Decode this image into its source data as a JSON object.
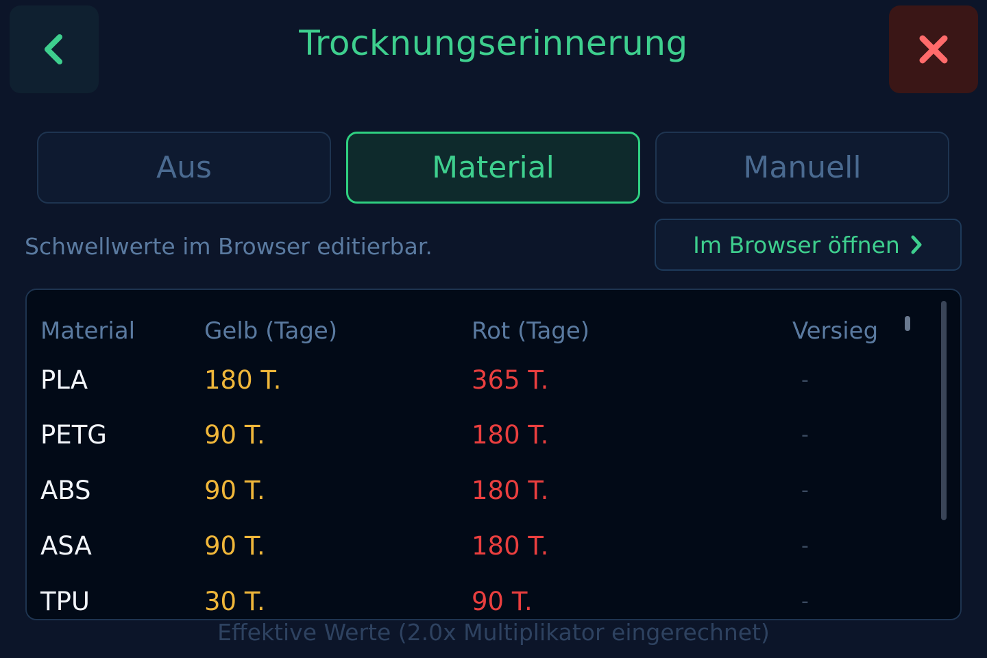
{
  "header": {
    "title": "Trocknungserinnerung",
    "back_icon": "chevron-left-icon",
    "close_icon": "close-icon"
  },
  "tabs": [
    {
      "label": "Aus",
      "active": false
    },
    {
      "label": "Material",
      "active": true
    },
    {
      "label": "Manuell",
      "active": false
    }
  ],
  "hint": "Schwellwerte im Browser editierbar.",
  "open_browser": {
    "label": "Im Browser öffnen",
    "icon": "chevron-right-icon"
  },
  "table": {
    "headers": {
      "material": "Material",
      "yellow": "Gelb (Tage)",
      "red": "Rot (Tage)",
      "sealed": "Versieg"
    },
    "rows": [
      {
        "material": "PLA",
        "yellow": "180 T.",
        "red": "365 T.",
        "sealed": "-"
      },
      {
        "material": "PETG",
        "yellow": "90 T.",
        "red": "180 T.",
        "sealed": "-"
      },
      {
        "material": "ABS",
        "yellow": "90 T.",
        "red": "180 T.",
        "sealed": "-"
      },
      {
        "material": "ASA",
        "yellow": "90 T.",
        "red": "180 T.",
        "sealed": "-"
      },
      {
        "material": "TPU",
        "yellow": "30 T.",
        "red": "90 T.",
        "sealed": "-"
      }
    ]
  },
  "footer_note": "Effektive Werte (2.0x Multiplikator eingerechnet)",
  "colors": {
    "accent": "#3ecf8e",
    "yellow": "#f0b73a",
    "red": "#ea3f3f",
    "background": "#0c1529"
  }
}
